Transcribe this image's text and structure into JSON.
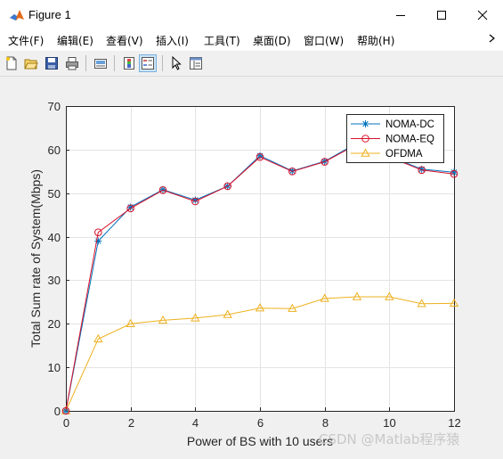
{
  "window": {
    "title": "Figure 1"
  },
  "menu": {
    "items": [
      "文件(F)",
      "编辑(E)",
      "查看(V)",
      "插入(I)",
      "工具(T)",
      "桌面(D)",
      "窗口(W)",
      "帮助(H)"
    ],
    "overflow_icon": "chevron-right-icon"
  },
  "toolbar": {
    "icons": [
      "new-figure-icon",
      "open-file-icon",
      "save-icon",
      "print-icon",
      "link-plot-icon",
      "insert-colorbar-icon",
      "insert-legend-icon",
      "pointer-icon",
      "property-inspector-icon"
    ]
  },
  "watermark": "CSDN @Matlab程序猿",
  "colors": {
    "noma_dc": "#0072BD",
    "noma_eq": "#D9112B",
    "ofdma": "#EDB120"
  },
  "chart_data": {
    "type": "line",
    "xlabel": "Power of BS with 10 users",
    "ylabel": "Total Sum rate of System(Mbps)",
    "xlim": [
      0,
      12
    ],
    "ylim": [
      0,
      70
    ],
    "xticks": [
      0,
      2,
      4,
      6,
      8,
      10,
      12
    ],
    "yticks": [
      0,
      10,
      20,
      30,
      40,
      50,
      60,
      70
    ],
    "grid": true,
    "legend_position": "top-right",
    "x": [
      0,
      1,
      2,
      3,
      4,
      5,
      6,
      7,
      8,
      9,
      10,
      11,
      12
    ],
    "series": [
      {
        "name": "NOMA-DC",
        "marker": "asterisk",
        "color": "#0072BD",
        "values": [
          0,
          39,
          46.8,
          50.8,
          48.4,
          51.6,
          58.6,
          55.1,
          57.3,
          61.5,
          58.5,
          55.5,
          54.8
        ]
      },
      {
        "name": "NOMA-EQ",
        "marker": "circle",
        "color": "#D9112B",
        "values": [
          0,
          41,
          46.5,
          50.7,
          48.1,
          51.6,
          58.3,
          55.0,
          57.2,
          61.2,
          58.3,
          55.3,
          54.4
        ]
      },
      {
        "name": "OFDMA",
        "marker": "triangle",
        "color": "#EDB120",
        "values": [
          0,
          16.5,
          20,
          20.8,
          21.3,
          22.1,
          23.6,
          23.5,
          25.8,
          26.2,
          26.2,
          24.6,
          24.7
        ]
      }
    ]
  }
}
